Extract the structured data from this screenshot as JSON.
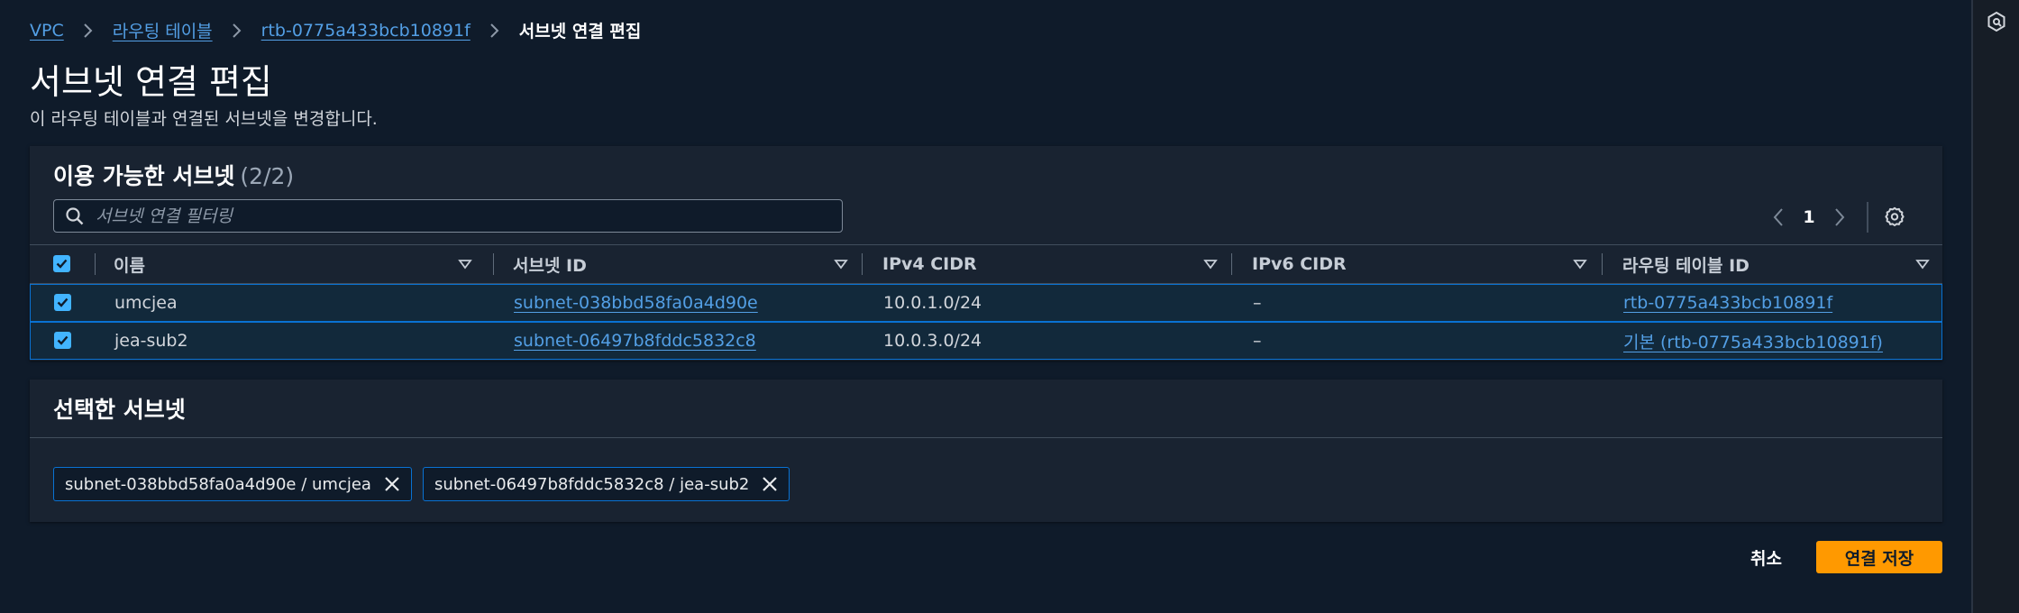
{
  "breadcrumb": {
    "items": [
      "VPC",
      "라우팅 테이블",
      "rtb-0775a433bcb10891f"
    ],
    "current": "서브넷 연결 편집"
  },
  "page": {
    "title": "서브넷 연결 편집",
    "description": "이 라우팅 테이블과 연결된 서브넷을 변경합니다."
  },
  "available": {
    "title": "이용 가능한 서브넷",
    "count": "(2/2)",
    "filter_placeholder": "서브넷 연결 필터링",
    "page": "1",
    "columns": [
      "이름",
      "서브넷 ID",
      "IPv4 CIDR",
      "IPv6 CIDR",
      "라우팅 테이블 ID"
    ],
    "rows": [
      {
        "name": "umcjea",
        "subnet_id": "subnet-038bbd58fa0a4d90e",
        "ipv4": "10.0.1.0/24",
        "ipv6": "–",
        "route_table": "rtb-0775a433bcb10891f",
        "checked": true
      },
      {
        "name": "jea-sub2",
        "subnet_id": "subnet-06497b8fddc5832c8",
        "ipv4": "10.0.3.0/24",
        "ipv6": "–",
        "route_table": "기본 (rtb-0775a433bcb10891f)",
        "checked": true
      }
    ]
  },
  "selected": {
    "title": "선택한 서브넷",
    "tokens": [
      "subnet-038bbd58fa0a4d90e / umcjea",
      "subnet-06497b8fddc5832c8 / jea-sub2"
    ]
  },
  "actions": {
    "cancel": "취소",
    "save": "연결 저장"
  },
  "colors": {
    "background": "#0f1b2a",
    "panel": "#192331",
    "link": "#539fe5",
    "accent": "#ff9900",
    "selection_border": "#0972d3",
    "checkbox": "#42b4ff"
  }
}
